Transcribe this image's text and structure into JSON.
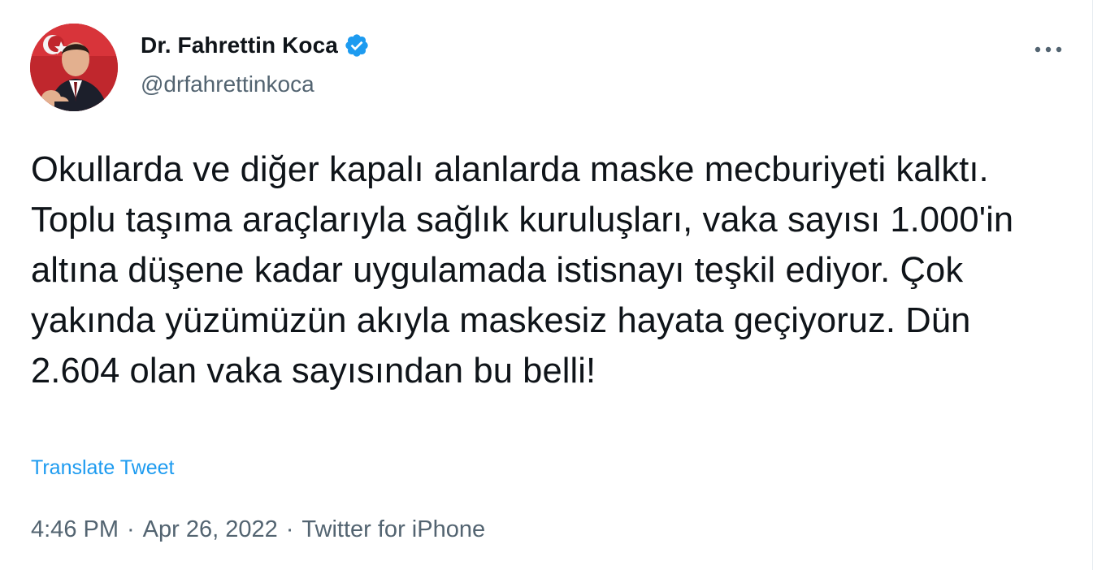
{
  "author": {
    "display_name": "Dr. Fahrettin Koca",
    "handle": "@drfahrettinkoca",
    "verified_icon": "verified-badge-icon",
    "avatar_icon": "profile-photo"
  },
  "menu": {
    "more_icon": "more-horizontal-icon"
  },
  "tweet": {
    "text": "Okullarda ve diğer kapalı alanlarda maske mecburiyeti kalktı. Toplu taşıma araçlarıyla sağlık kuruluşları, vaka sayısı 1.000'in altına düşene kadar uygulamada istisnayı teşkil ediyor. Çok yakında yüzümüzün akıyla maskesiz hayata geçiyoruz. Dün 2.604 olan vaka sayısından bu belli!",
    "translate_label": "Translate Tweet"
  },
  "meta": {
    "time": "4:46 PM",
    "separator": "·",
    "date": "Apr 26, 2022",
    "source": "Twitter for iPhone"
  },
  "colors": {
    "link": "#1d9bf0",
    "secondary_text": "#536471",
    "primary_text": "#0f1419",
    "verified": "#1d9bf0"
  }
}
